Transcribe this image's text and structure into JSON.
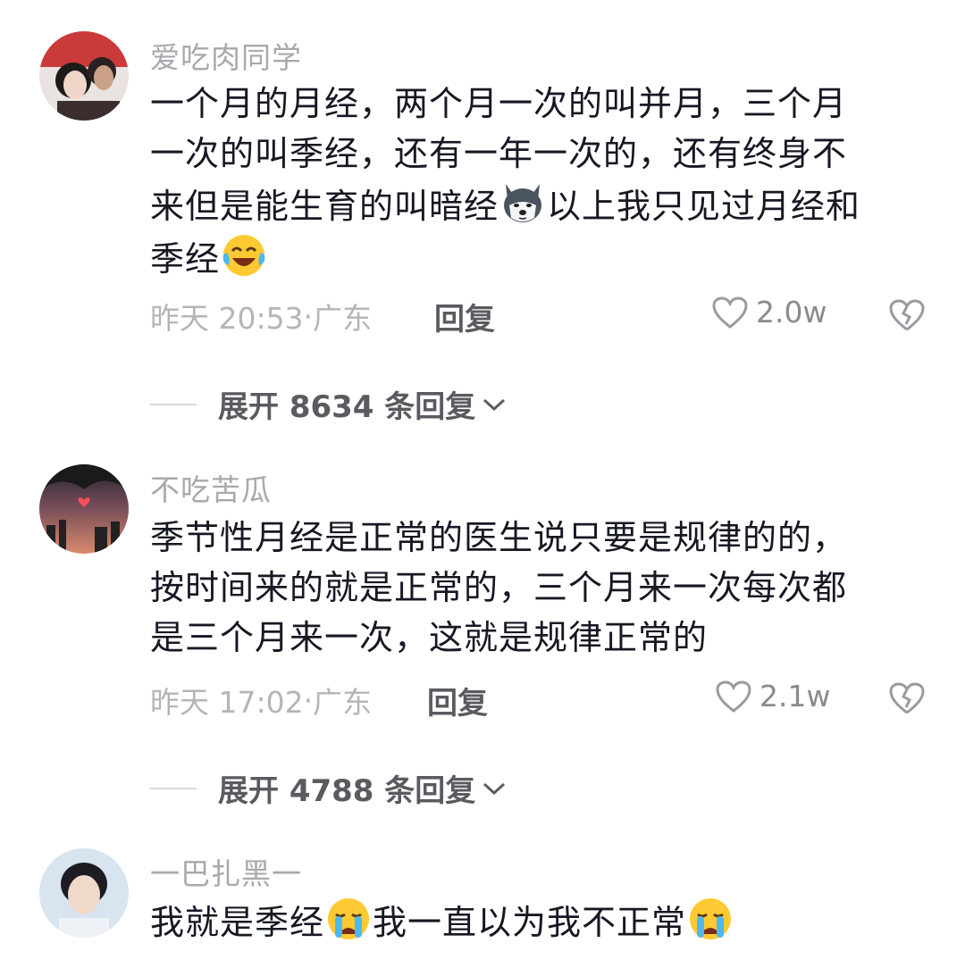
{
  "comments": [
    {
      "username": "爱吃肉同学",
      "text_lines": [
        "一个月的月经，两个月一次的叫并月，三个月",
        "一次的叫季经，还有一年一次的，还有终身不",
        "来但是能生育的叫暗经",
        "以上我只见过月经和",
        "季经"
      ],
      "emojis": [
        "husky-dog-emoji",
        "laughing-tears-emoji"
      ],
      "time": "昨天 20:53",
      "location": "广东",
      "reply_label": "回复",
      "likes": "2.0w",
      "expand_label": "展开 8634 条回复"
    },
    {
      "username": "不吃苦瓜",
      "text_lines": [
        "季节性月经是正常的医生说只要是规律的的，",
        "按时间来的就是正常的，三个月来一次每次都",
        "是三个月来一次，这就是规律正常的"
      ],
      "time": "昨天 17:02",
      "location": "广东",
      "reply_label": "回复",
      "likes": "2.1w",
      "expand_label": "展开 4788 条回复"
    },
    {
      "username": "一巴扎黑一",
      "text_lines": [
        "我就是季经",
        "我一直以为我不正常"
      ],
      "emojis": [
        "crying-emoji",
        "crying-emoji"
      ]
    }
  ],
  "icons": {
    "like": "heart-outline-icon",
    "dislike": "broken-heart-icon",
    "expand": "chevron-down-icon"
  },
  "colors": {
    "username": "#a8a8ad",
    "body": "#161823",
    "meta": "#b5b5b9",
    "reply": "#5a5a60"
  }
}
